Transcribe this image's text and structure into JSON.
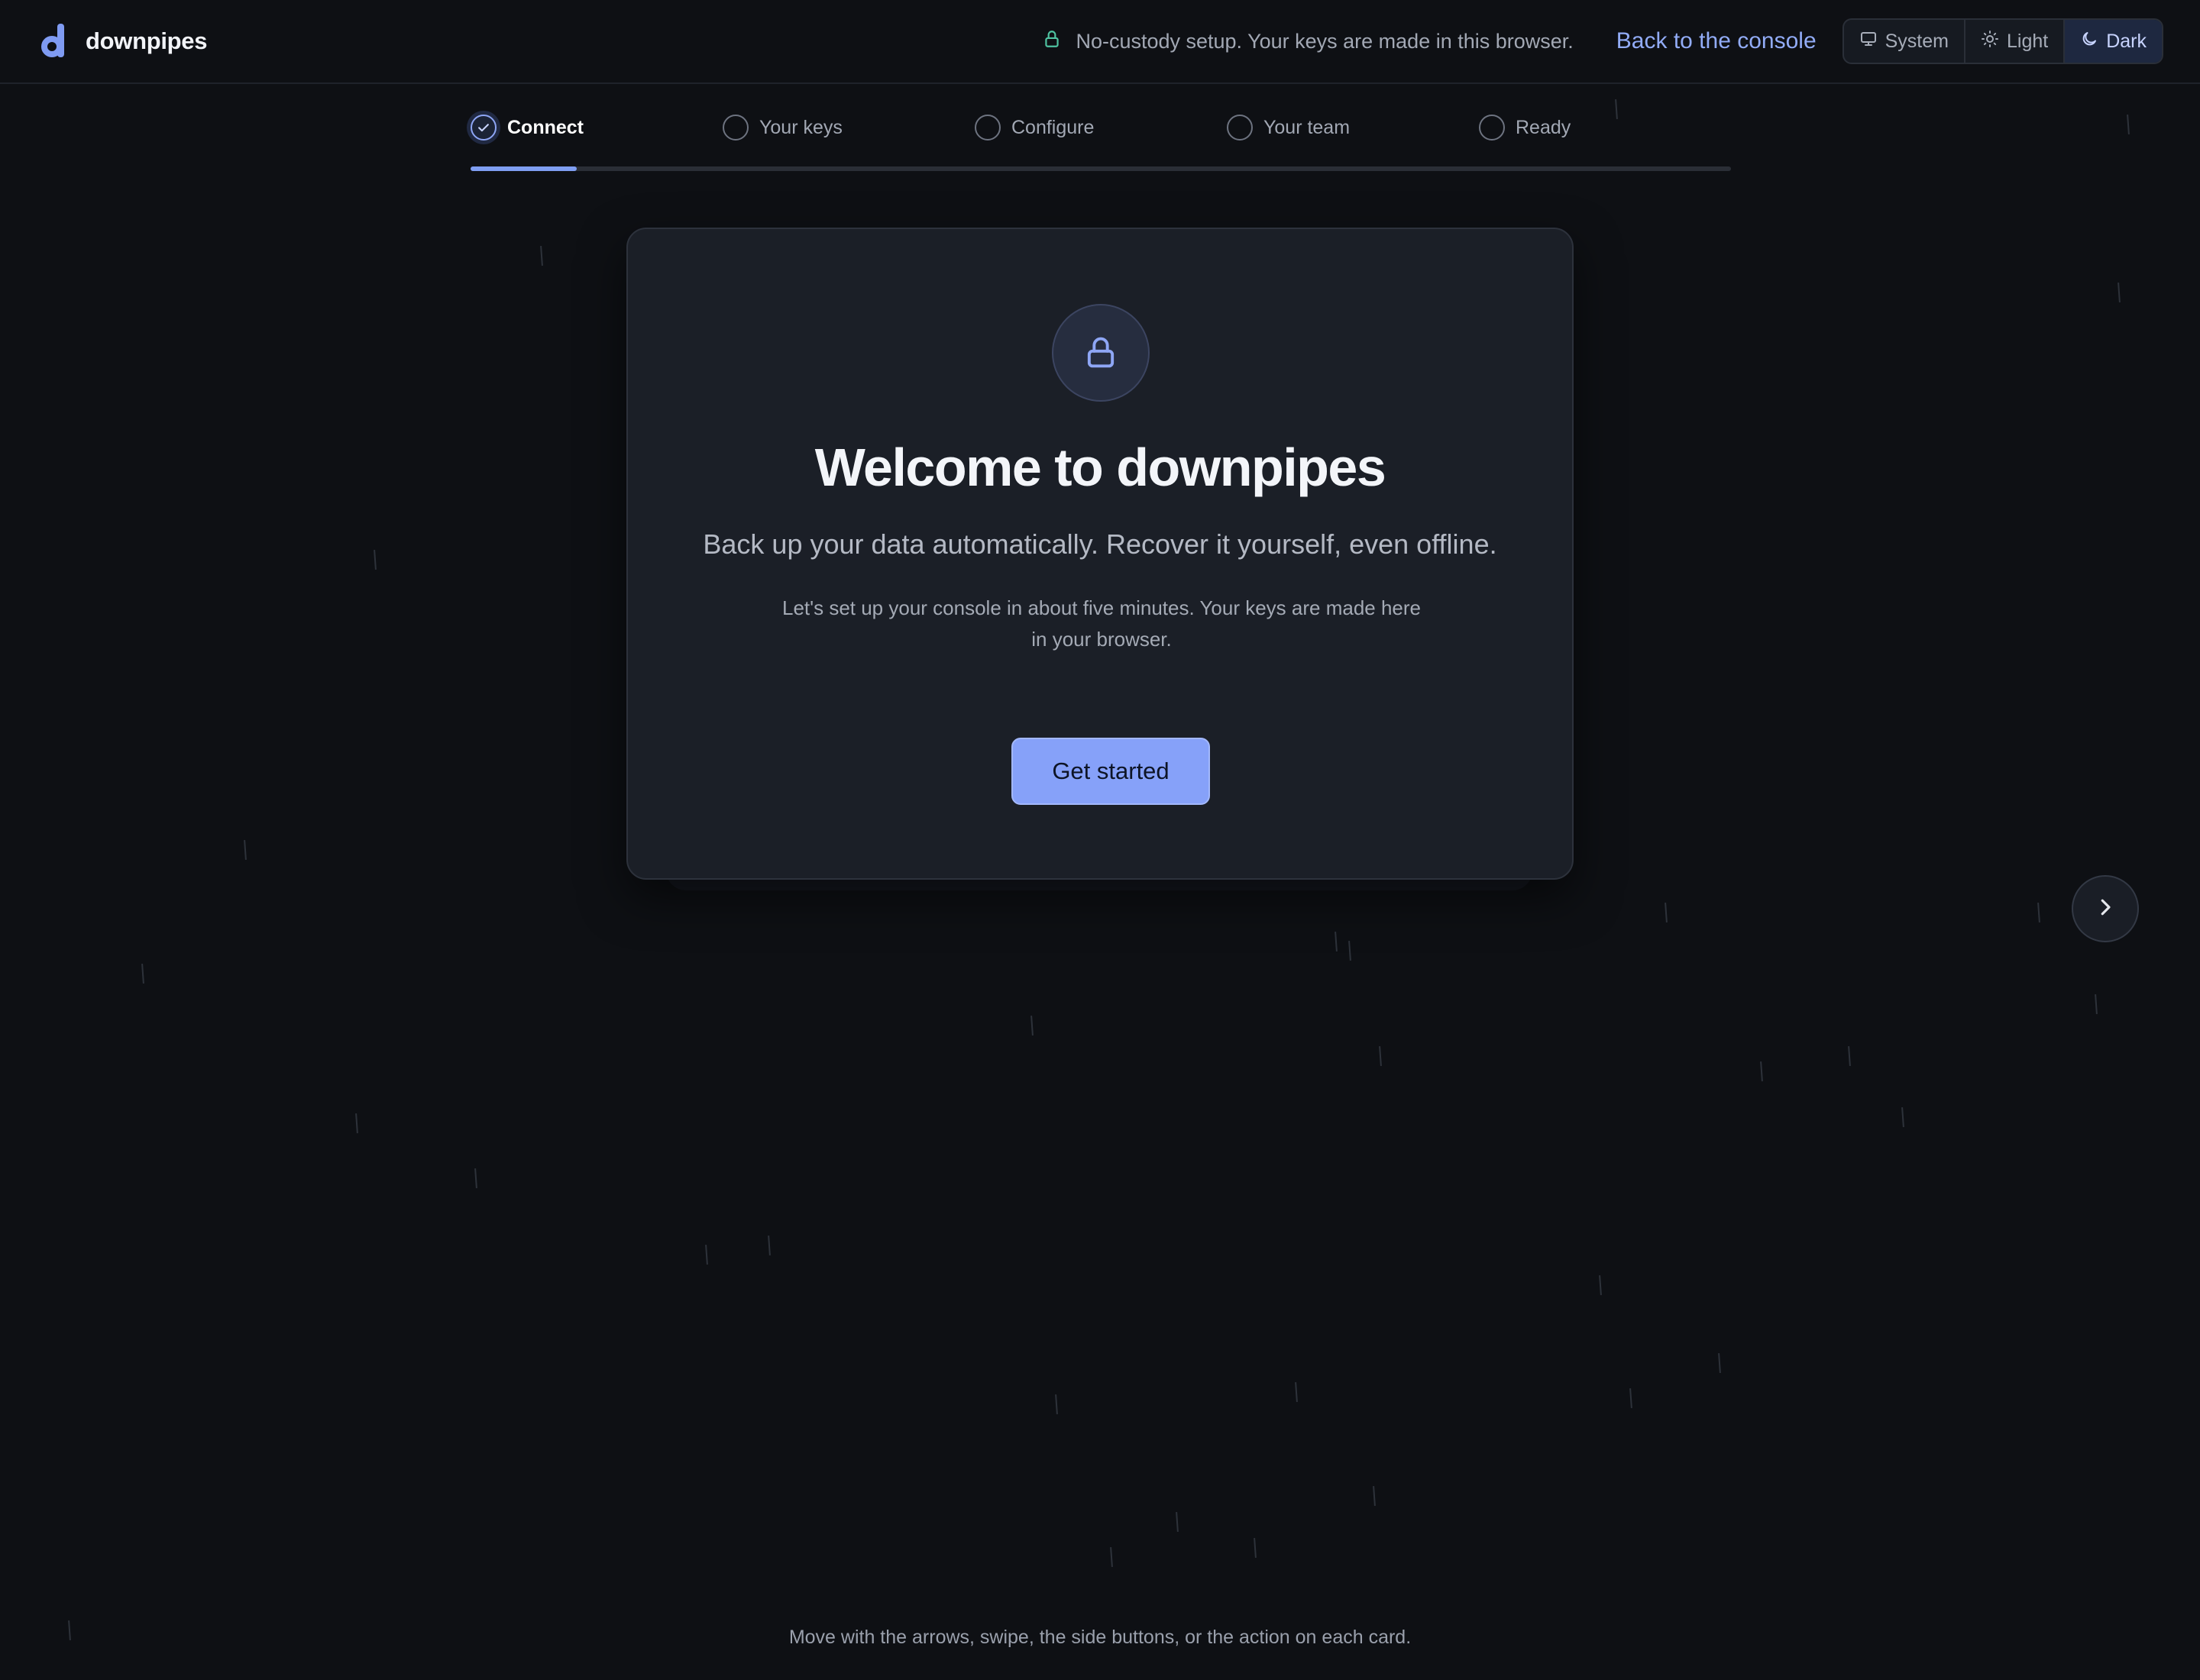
{
  "header": {
    "brand_name": "downpipes",
    "notice": "No-custody setup. Your keys are made in this browser.",
    "back_link": "Back to the console",
    "theme_options": [
      "System",
      "Light",
      "Dark"
    ],
    "active_theme": "Dark"
  },
  "stepper": {
    "steps": [
      "Connect",
      "Your keys",
      "Configure",
      "Your team",
      "Ready"
    ],
    "active_step": "Connect",
    "progress_fraction": 0.084
  },
  "card": {
    "title": "Welcome to downpipes",
    "subtitle": "Back up your data automatically. Recover it yourself, even offline.",
    "body": "Let's set up your console in about five minutes. Your keys are made here in your browser.",
    "cta_label": "Get started"
  },
  "footer": {
    "hint": "Move with the arrows, swipe, the side buttons, or the action on each card."
  },
  "colors": {
    "background": "#0e1014",
    "accent": "#86a1f9",
    "card": "#1b1f27",
    "notice_lock": "#4fc3a1"
  }
}
